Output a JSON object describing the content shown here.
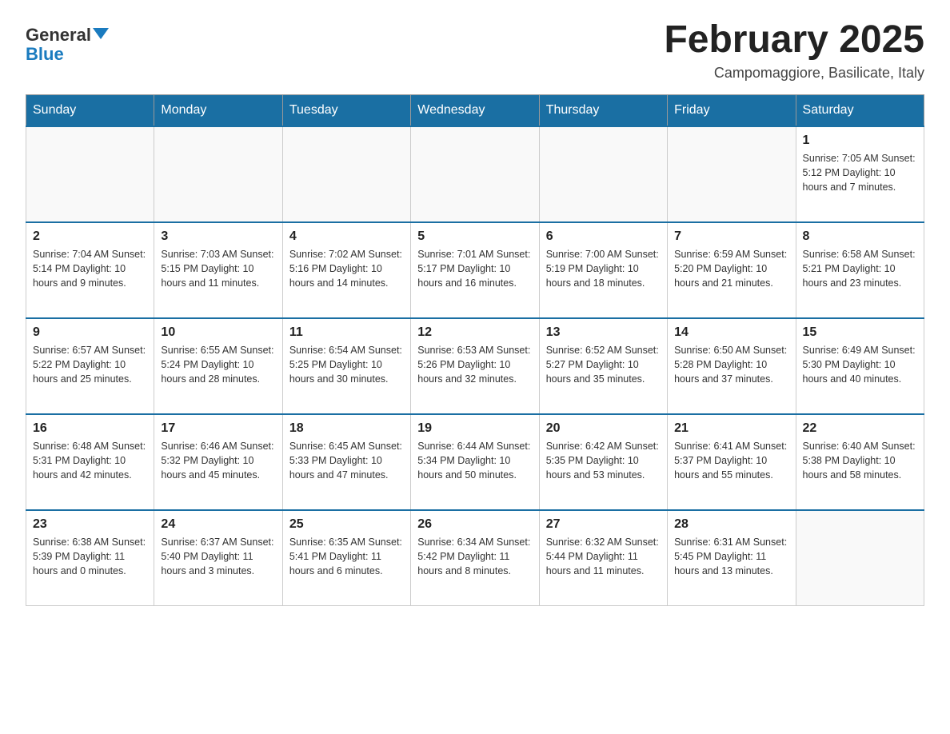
{
  "header": {
    "logo_general": "General",
    "logo_blue": "Blue",
    "month_title": "February 2025",
    "location": "Campomaggiore, Basilicate, Italy"
  },
  "days_of_week": [
    "Sunday",
    "Monday",
    "Tuesday",
    "Wednesday",
    "Thursday",
    "Friday",
    "Saturday"
  ],
  "weeks": [
    {
      "days": [
        {
          "num": "",
          "info": ""
        },
        {
          "num": "",
          "info": ""
        },
        {
          "num": "",
          "info": ""
        },
        {
          "num": "",
          "info": ""
        },
        {
          "num": "",
          "info": ""
        },
        {
          "num": "",
          "info": ""
        },
        {
          "num": "1",
          "info": "Sunrise: 7:05 AM\nSunset: 5:12 PM\nDaylight: 10 hours and 7 minutes."
        }
      ]
    },
    {
      "days": [
        {
          "num": "2",
          "info": "Sunrise: 7:04 AM\nSunset: 5:14 PM\nDaylight: 10 hours and 9 minutes."
        },
        {
          "num": "3",
          "info": "Sunrise: 7:03 AM\nSunset: 5:15 PM\nDaylight: 10 hours and 11 minutes."
        },
        {
          "num": "4",
          "info": "Sunrise: 7:02 AM\nSunset: 5:16 PM\nDaylight: 10 hours and 14 minutes."
        },
        {
          "num": "5",
          "info": "Sunrise: 7:01 AM\nSunset: 5:17 PM\nDaylight: 10 hours and 16 minutes."
        },
        {
          "num": "6",
          "info": "Sunrise: 7:00 AM\nSunset: 5:19 PM\nDaylight: 10 hours and 18 minutes."
        },
        {
          "num": "7",
          "info": "Sunrise: 6:59 AM\nSunset: 5:20 PM\nDaylight: 10 hours and 21 minutes."
        },
        {
          "num": "8",
          "info": "Sunrise: 6:58 AM\nSunset: 5:21 PM\nDaylight: 10 hours and 23 minutes."
        }
      ]
    },
    {
      "days": [
        {
          "num": "9",
          "info": "Sunrise: 6:57 AM\nSunset: 5:22 PM\nDaylight: 10 hours and 25 minutes."
        },
        {
          "num": "10",
          "info": "Sunrise: 6:55 AM\nSunset: 5:24 PM\nDaylight: 10 hours and 28 minutes."
        },
        {
          "num": "11",
          "info": "Sunrise: 6:54 AM\nSunset: 5:25 PM\nDaylight: 10 hours and 30 minutes."
        },
        {
          "num": "12",
          "info": "Sunrise: 6:53 AM\nSunset: 5:26 PM\nDaylight: 10 hours and 32 minutes."
        },
        {
          "num": "13",
          "info": "Sunrise: 6:52 AM\nSunset: 5:27 PM\nDaylight: 10 hours and 35 minutes."
        },
        {
          "num": "14",
          "info": "Sunrise: 6:50 AM\nSunset: 5:28 PM\nDaylight: 10 hours and 37 minutes."
        },
        {
          "num": "15",
          "info": "Sunrise: 6:49 AM\nSunset: 5:30 PM\nDaylight: 10 hours and 40 minutes."
        }
      ]
    },
    {
      "days": [
        {
          "num": "16",
          "info": "Sunrise: 6:48 AM\nSunset: 5:31 PM\nDaylight: 10 hours and 42 minutes."
        },
        {
          "num": "17",
          "info": "Sunrise: 6:46 AM\nSunset: 5:32 PM\nDaylight: 10 hours and 45 minutes."
        },
        {
          "num": "18",
          "info": "Sunrise: 6:45 AM\nSunset: 5:33 PM\nDaylight: 10 hours and 47 minutes."
        },
        {
          "num": "19",
          "info": "Sunrise: 6:44 AM\nSunset: 5:34 PM\nDaylight: 10 hours and 50 minutes."
        },
        {
          "num": "20",
          "info": "Sunrise: 6:42 AM\nSunset: 5:35 PM\nDaylight: 10 hours and 53 minutes."
        },
        {
          "num": "21",
          "info": "Sunrise: 6:41 AM\nSunset: 5:37 PM\nDaylight: 10 hours and 55 minutes."
        },
        {
          "num": "22",
          "info": "Sunrise: 6:40 AM\nSunset: 5:38 PM\nDaylight: 10 hours and 58 minutes."
        }
      ]
    },
    {
      "days": [
        {
          "num": "23",
          "info": "Sunrise: 6:38 AM\nSunset: 5:39 PM\nDaylight: 11 hours and 0 minutes."
        },
        {
          "num": "24",
          "info": "Sunrise: 6:37 AM\nSunset: 5:40 PM\nDaylight: 11 hours and 3 minutes."
        },
        {
          "num": "25",
          "info": "Sunrise: 6:35 AM\nSunset: 5:41 PM\nDaylight: 11 hours and 6 minutes."
        },
        {
          "num": "26",
          "info": "Sunrise: 6:34 AM\nSunset: 5:42 PM\nDaylight: 11 hours and 8 minutes."
        },
        {
          "num": "27",
          "info": "Sunrise: 6:32 AM\nSunset: 5:44 PM\nDaylight: 11 hours and 11 minutes."
        },
        {
          "num": "28",
          "info": "Sunrise: 6:31 AM\nSunset: 5:45 PM\nDaylight: 11 hours and 13 minutes."
        },
        {
          "num": "",
          "info": ""
        }
      ]
    }
  ]
}
